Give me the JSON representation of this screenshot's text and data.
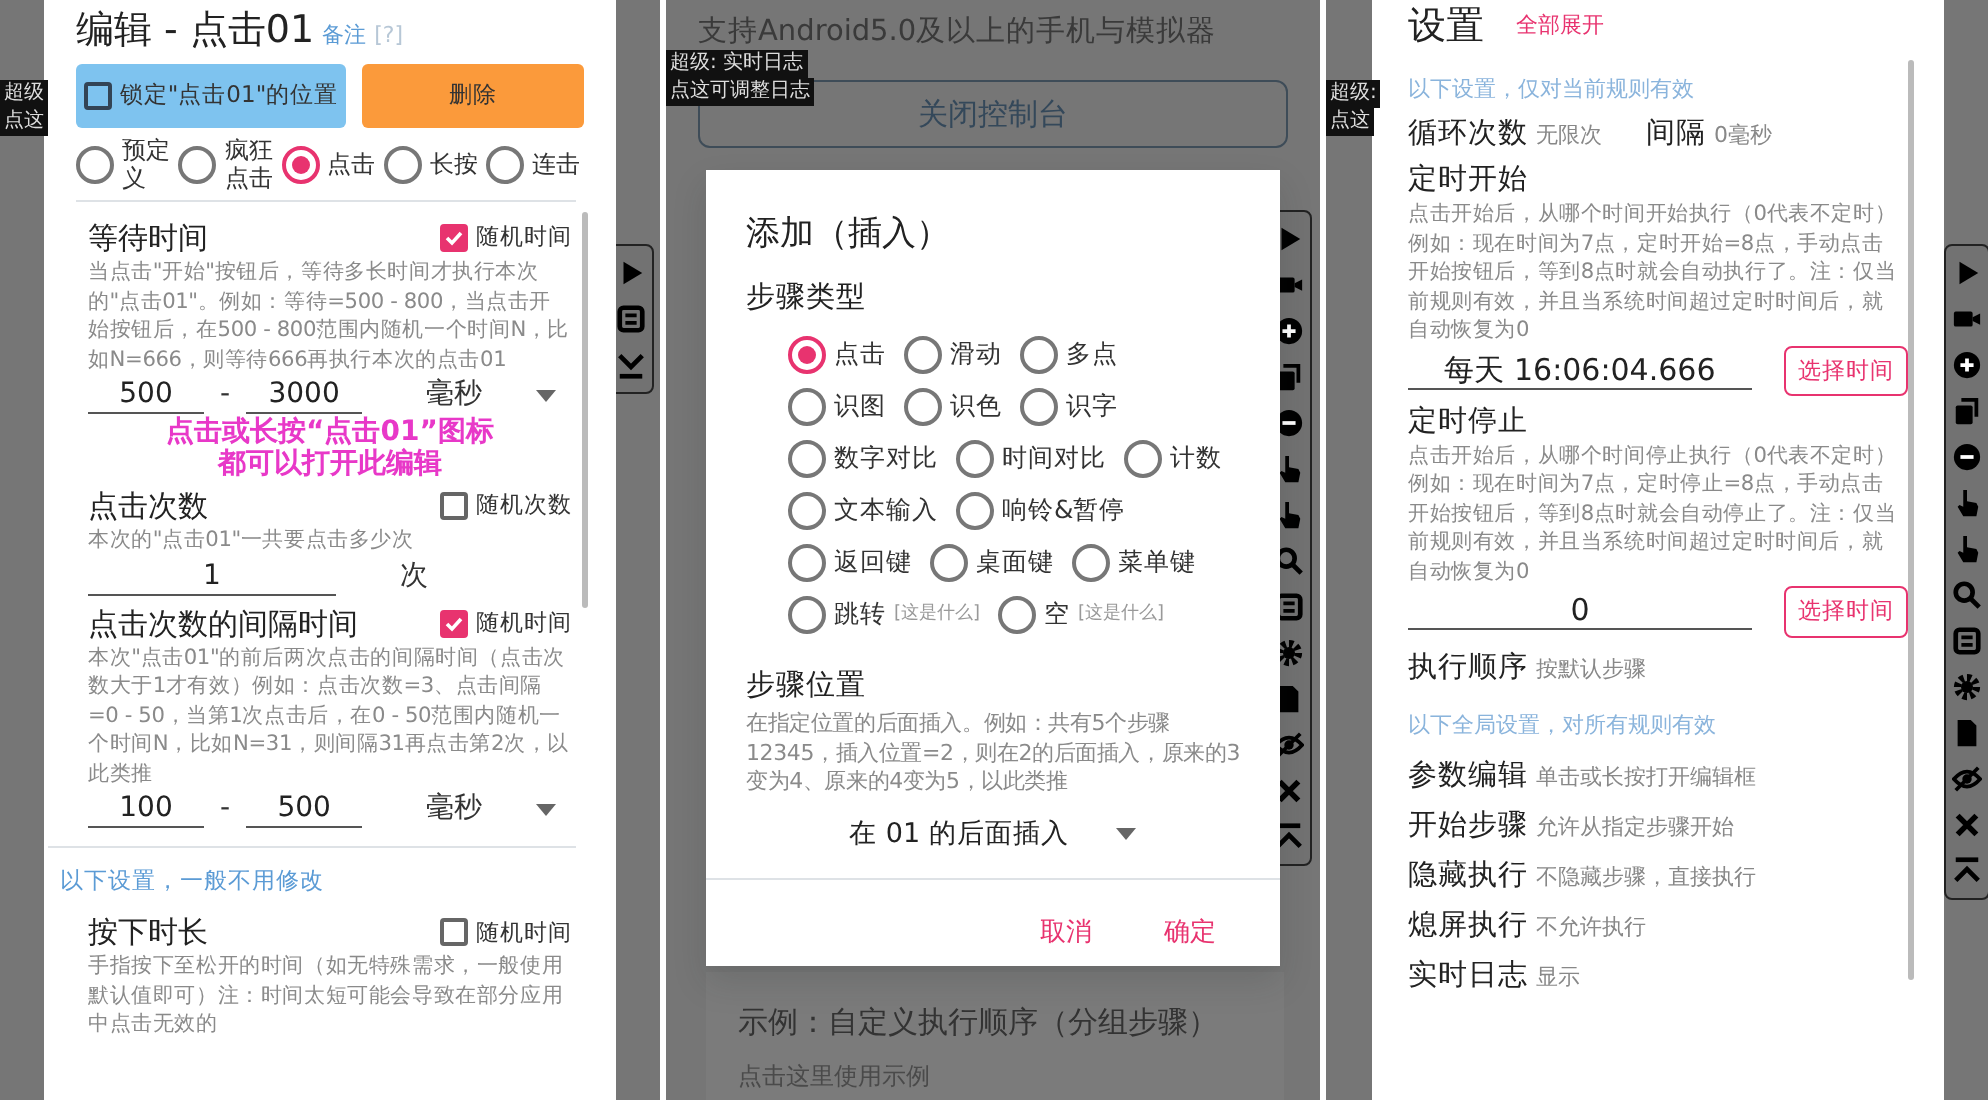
{
  "edit_screen": {
    "tags": [
      "超级",
      "点这"
    ],
    "title": "编辑 - 点击01",
    "note_link": "备注",
    "help_link": "[?]",
    "lock": {
      "label": "锁定\"点击01\"的位置",
      "checked": false
    },
    "delete_button": "删除",
    "modes": [
      {
        "label": "预定义",
        "selected": false
      },
      {
        "label": "疯狂点击",
        "selected": false
      },
      {
        "label": "点击",
        "selected": true
      },
      {
        "label": "长按",
        "selected": false
      },
      {
        "label": "连击",
        "selected": false
      }
    ],
    "sections": [
      {
        "kind": "range",
        "title": "等待时间",
        "random": {
          "label": "随机时间",
          "checked": true
        },
        "description": "当点击\"开始\"按钮后，等待多长时间才执行本次的\"点击01\"。例如：等待=500 - 800，当点击开始按钮后，在500 - 800范围内随机一个时间N，比如N=666，则等待666再执行本次的点击01",
        "from": "500",
        "separator": "-",
        "to": "3000",
        "unit": "毫秒"
      },
      {
        "kind": "caption",
        "lines": [
          "点击或长按“点击01”图标",
          "都可以打开此编辑"
        ]
      },
      {
        "kind": "single",
        "title": "点击次数",
        "random": {
          "label": "随机次数",
          "checked": false
        },
        "description": "本次的\"点击01\"一共要点击多少次",
        "value": "1",
        "unit": "次"
      },
      {
        "kind": "range",
        "title": "点击次数的间隔时间",
        "random": {
          "label": "随机时间",
          "checked": true
        },
        "description": "本次\"点击01\"的前后两次点击的间隔时间（点击次数大于1才有效）例如：点击次数=3、点击间隔=0 - 50，当第1次点击后，在0 - 50范围内随机一个时间N，比如N=31，则间隔31再点击第2次，以此类推",
        "from": "100",
        "separator": "-",
        "to": "500",
        "unit": "毫秒"
      },
      {
        "kind": "hint",
        "text": "以下设置，一般不用修改"
      },
      {
        "kind": "info",
        "title": "按下时长",
        "random": {
          "label": "随机时间",
          "checked": false
        },
        "description": "手指按下至松开的时间（如无特殊需求，一般使用默认值即可）注：时间太短可能会导致在部分应用中点击无效的"
      }
    ]
  },
  "insert_screen": {
    "tags": [
      "超级: 实时日志",
      "点这可调整日志"
    ],
    "notice": "支持Android5.0及以上的手机与模拟器",
    "close_console_button": "关闭控制台",
    "dialog": {
      "title": "添加（插入）",
      "step_type_label": "步骤类型",
      "step_type_rows": [
        {
          "options": [
            {
              "label": "点击",
              "selected": true
            },
            {
              "label": "滑动",
              "selected": false
            },
            {
              "label": "多点",
              "selected": false
            }
          ]
        },
        {
          "options": [
            {
              "label": "识图",
              "selected": false
            },
            {
              "label": "识色",
              "selected": false
            },
            {
              "label": "识字",
              "selected": false
            }
          ]
        },
        {
          "options": [
            {
              "label": "数字对比",
              "selected": false
            },
            {
              "label": "时间对比",
              "selected": false
            },
            {
              "label": "计数",
              "selected": false
            }
          ]
        },
        {
          "options": [
            {
              "label": "文本输入",
              "selected": false
            },
            {
              "label": "响铃&暂停",
              "selected": false
            }
          ]
        },
        {
          "options": [
            {
              "label": "返回键",
              "selected": false
            },
            {
              "label": "桌面键",
              "selected": false
            },
            {
              "label": "菜单键",
              "selected": false
            }
          ]
        },
        {
          "options": [
            {
              "label": "跳转",
              "help": "[这是什么]",
              "selected": false
            },
            {
              "label": "空",
              "help": "[这是什么]",
              "selected": false
            }
          ]
        }
      ],
      "position_label": "步骤位置",
      "position_description": "在指定位置的后面插入。例如：共有5个步骤12345，插入位置=2，则在2的后面插入，原来的3变为4、原来的4变为5，以此类推",
      "position_select": "在 01 的后面插入",
      "buttons": [
        "取消",
        "确定"
      ]
    },
    "example": {
      "title": "示例：自定义执行顺序（分组步骤）",
      "link": "点击这里使用示例"
    }
  },
  "settings_screen": {
    "tags": [
      "超级:",
      "点这"
    ],
    "title": "设置",
    "expand_link": "全部展开",
    "sections": [
      {
        "kind": "hint",
        "text": "以下设置，仅对当前规则有效"
      },
      {
        "kind": "pair",
        "items": [
          {
            "label": "循环次数",
            "value": "无限次"
          },
          {
            "label": "间隔",
            "value": "0毫秒"
          }
        ]
      },
      {
        "kind": "timer",
        "title": "定时开始",
        "description": "点击开始后，从哪个时间开始执行（0代表不定时）例如：现在时间为7点，定时开始=8点，手动点击开始按钮后，等到8点时就会自动执行了。注：仅当前规则有效，并且当系统时间超过定时时间后，就自动恢复为0",
        "value": "每天 16:06:04.666",
        "button": "选择时间"
      },
      {
        "kind": "timer",
        "title": "定时停止",
        "description": "点击开始后，从哪个时间停止执行（0代表不定时）例如：现在时间为7点，定时停止=8点，手动点击开始按钮后，等到8点时就会自动停止了。注：仅当前规则有效，并且当系统时间超过定时时间后，就自动恢复为0",
        "value": "0",
        "button": "选择时间"
      },
      {
        "kind": "setting",
        "label": "执行顺序",
        "value": "按默认步骤"
      },
      {
        "kind": "hint",
        "text": "以下全局设置，对所有规则有效"
      },
      {
        "kind": "setting",
        "label": "参数编辑",
        "value": "单击或长按打开编辑框"
      },
      {
        "kind": "setting",
        "label": "开始步骤",
        "value": "允许从指定步骤开始"
      },
      {
        "kind": "setting",
        "label": "隐藏执行",
        "value": "不隐藏步骤，直接执行"
      },
      {
        "kind": "setting",
        "label": "熄屏执行",
        "value": "不允许执行"
      },
      {
        "kind": "setting",
        "label": "实时日志",
        "value": "显示"
      }
    ]
  }
}
